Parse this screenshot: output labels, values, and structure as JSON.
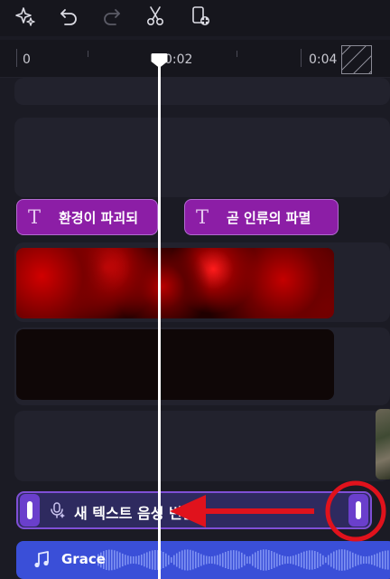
{
  "toolbar": {
    "icons": [
      "magic-sparkle-icon",
      "undo-icon",
      "redo-icon",
      "scissors-icon",
      "add-page-icon"
    ]
  },
  "ruler": {
    "labels": [
      "0",
      "0:02",
      "0:04"
    ]
  },
  "timeline": {
    "text_clips": [
      {
        "glyph": "T",
        "label": "환경이 파괴되"
      },
      {
        "glyph": "T",
        "label": "곧 인류의 파멸"
      }
    ],
    "voice_clip": {
      "label": "새 텍스트 음성 변환"
    },
    "music_clip": {
      "label": "Grace"
    }
  },
  "colors": {
    "accent_purple": "#8c1ea6",
    "voice_border": "#7f4fd6",
    "music_blue": "#3a4fd8",
    "annotation_red": "#e0121c",
    "playhead": "#ffffff"
  }
}
